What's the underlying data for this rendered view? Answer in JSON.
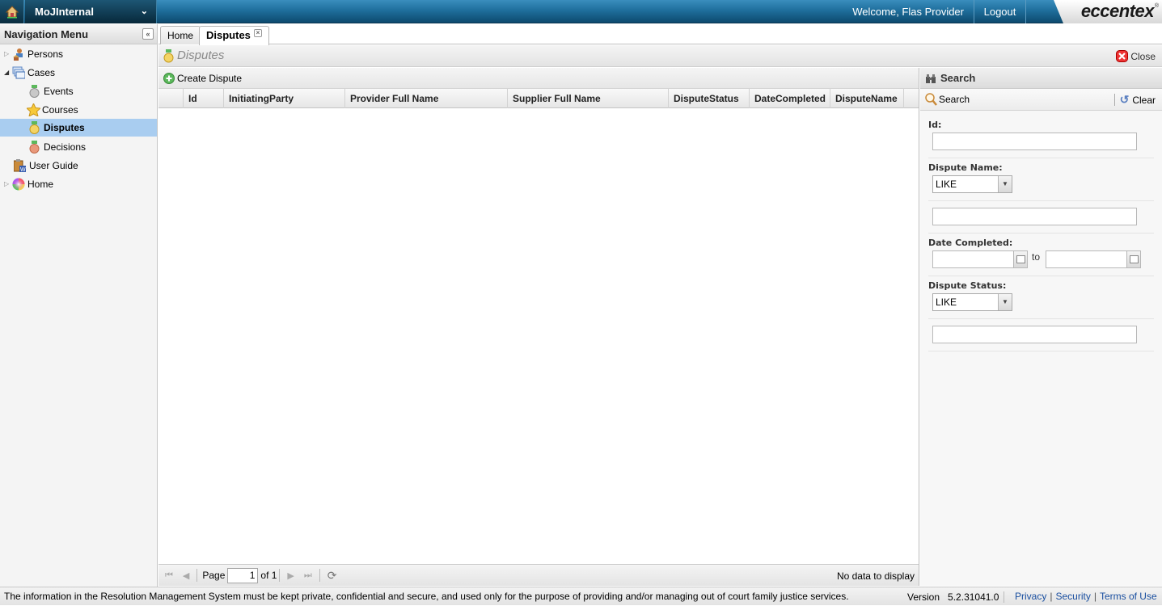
{
  "header": {
    "app_name": "MoJInternal",
    "welcome_text": "Welcome, Flas Provider",
    "logout_label": "Logout",
    "logo_text": "eccentex",
    "brand_color": "#1f6f9d"
  },
  "nav": {
    "title": "Navigation Menu",
    "items": [
      {
        "label": "Persons",
        "icon": "persons-icon",
        "expandable": true,
        "expanded": false
      },
      {
        "label": "Cases",
        "icon": "cases-icon",
        "expandable": true,
        "expanded": true
      },
      {
        "label": "Events",
        "icon": "grey-medal-icon"
      },
      {
        "label": "Courses",
        "icon": "star-icon"
      },
      {
        "label": "Disputes",
        "icon": "gold-medal-icon",
        "selected": true
      },
      {
        "label": "Decisions",
        "icon": "bronze-medal-icon"
      },
      {
        "label": "User Guide",
        "icon": "user-guide-icon"
      },
      {
        "label": "Home",
        "icon": "color-wheel-icon",
        "expandable": true,
        "expanded": false
      }
    ]
  },
  "tabs": [
    {
      "label": "Home"
    },
    {
      "label": "Disputes",
      "active": true,
      "closable": true
    }
  ],
  "page": {
    "title": "Disputes",
    "close_label": "Close"
  },
  "grid": {
    "create_label": "Create Dispute",
    "columns": [
      "Id",
      "InitiatingParty",
      "Provider Full Name",
      "Supplier Full Name",
      "DisputeStatus",
      "DateCompleted",
      "DisputeName"
    ],
    "rows": [],
    "pager": {
      "page_label": "Page",
      "current_page": "1",
      "of_label": "of 1",
      "status": "No data to display"
    }
  },
  "search": {
    "title": "Search",
    "search_label": "Search",
    "clear_label": "Clear",
    "fields": {
      "id_label": "Id:",
      "id_value": "",
      "dispute_name_label": "Dispute Name:",
      "dispute_name_operator": "LIKE",
      "dispute_name_value": "",
      "date_completed_label": "Date Completed:",
      "date_from": "",
      "to_label": "to",
      "date_to": "",
      "dispute_status_label": "Dispute Status:",
      "dispute_status_operator": "LIKE",
      "dispute_status_value": ""
    }
  },
  "footer": {
    "notice": "The information in the Resolution Management System must be kept private, confidential and secure, and used only for the purpose of providing and/or managing out of court family justice services.",
    "version_label": "Version",
    "version": "5.2.31041.0",
    "links": [
      "Privacy",
      "Security",
      "Terms of Use"
    ]
  }
}
